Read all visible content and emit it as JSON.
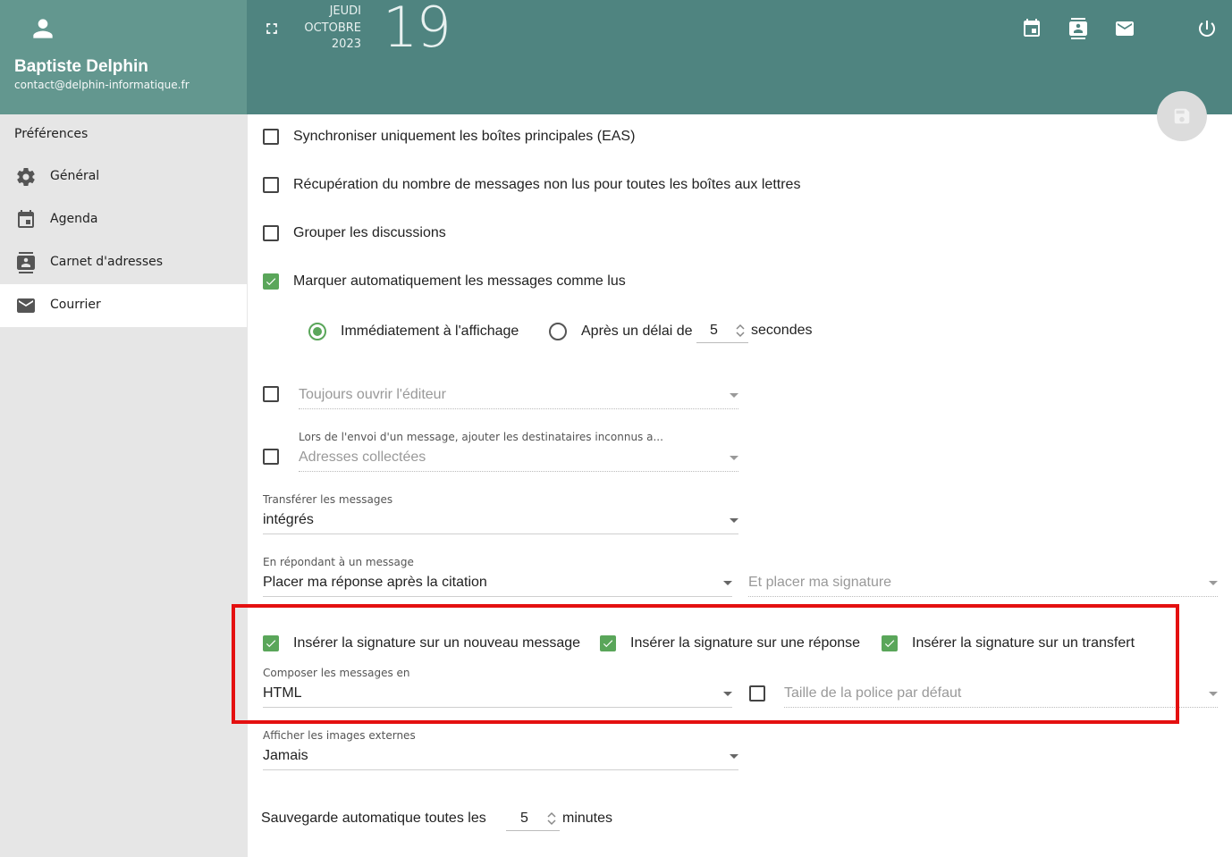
{
  "user": {
    "name": "Baptiste Delphin",
    "email": "contact@delphin-informatique.fr"
  },
  "sidebar": {
    "heading": "Préférences",
    "items": [
      {
        "label": "Général",
        "icon": "gear-icon",
        "active": false
      },
      {
        "label": "Agenda",
        "icon": "calendar-icon",
        "active": false
      },
      {
        "label": "Carnet d'adresses",
        "icon": "contacts-icon",
        "active": false
      },
      {
        "label": "Courrier",
        "icon": "mail-icon",
        "active": true
      }
    ]
  },
  "header": {
    "weekday": "JEUDI",
    "month": "OCTOBRE",
    "year": "2023",
    "day": "19",
    "icons": [
      "calendar-icon",
      "contacts-icon",
      "mail-icon",
      "power-icon"
    ]
  },
  "settings": {
    "sync_main": {
      "label": "Synchroniser uniquement les boîtes principales (EAS)",
      "checked": false
    },
    "unread_count": {
      "label": "Récupération du nombre de messages non lus pour toutes les boîtes aux lettres",
      "checked": false
    },
    "group_threads": {
      "label": "Grouper les discussions",
      "checked": false
    },
    "auto_mark_read": {
      "label": "Marquer automatiquement les messages comme lus",
      "checked": true
    },
    "mark_read_immediately": {
      "label": "Immédiatement à l'affichage",
      "selected": true
    },
    "mark_read_delay": {
      "prefix": "Après un délai de",
      "value": "5",
      "suffix": "secondes",
      "selected": false
    },
    "always_open_editor": {
      "value": "Toujours ouvrir l'éditeur",
      "checked": false
    },
    "unknown_recipients": {
      "caption": "Lors de l'envoi d'un message, ajouter les destinataires inconnus a...",
      "value": "Adresses collectées",
      "checked": false
    },
    "forward": {
      "caption": "Transférer les messages",
      "value": "intégrés"
    },
    "reply": {
      "caption": "En répondant à un message",
      "value": "Placer ma réponse après la citation",
      "signature_placeholder": "Et placer ma signature"
    },
    "signature_new": {
      "label": "Insérer la signature sur un nouveau message",
      "checked": true
    },
    "signature_reply": {
      "label": "Insérer la signature sur une réponse",
      "checked": true
    },
    "signature_forward": {
      "label": "Insérer la signature sur un transfert",
      "checked": true
    },
    "compose": {
      "caption": "Composer les messages en",
      "value": "HTML"
    },
    "font_size": {
      "value": "Taille de la police par défaut",
      "checked": false
    },
    "external_images": {
      "caption": "Afficher les images externes",
      "value": "Jamais"
    },
    "autosave": {
      "prefix": "Sauvegarde automatique toutes les",
      "value": "5",
      "suffix": "minutes"
    }
  },
  "colors": {
    "accent": "#5aa65a",
    "header": "#4f8480",
    "user_card": "#63978f",
    "highlight": "#e41010"
  }
}
